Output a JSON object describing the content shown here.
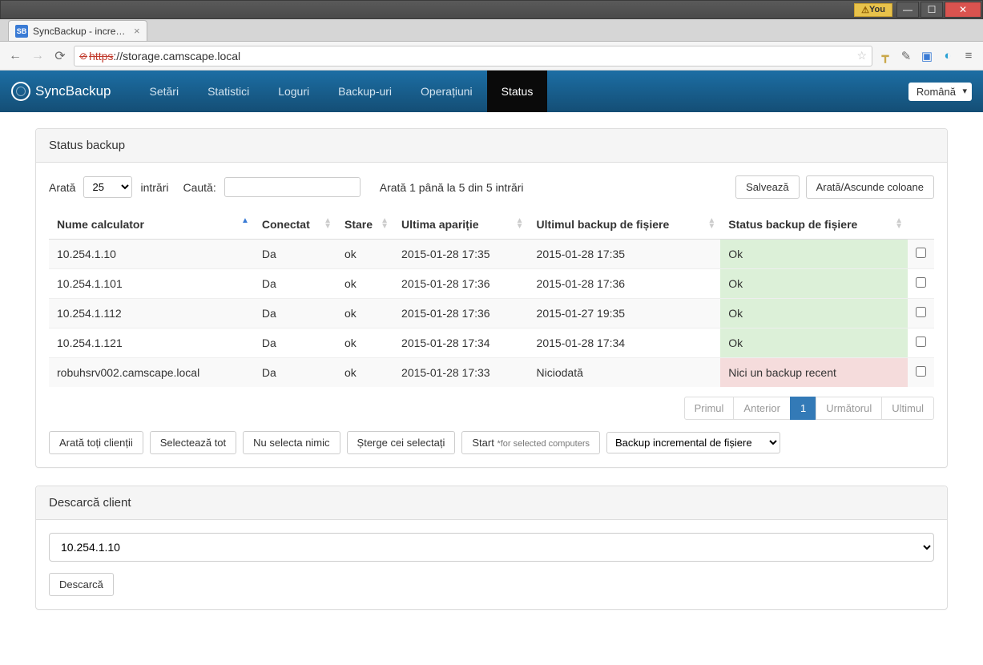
{
  "window": {
    "user_badge": "You",
    "tab_title": "SyncBackup - incremental",
    "tab_favicon": "SB",
    "url_proto": "https",
    "url_rest": "://storage.camscape.local"
  },
  "nav": {
    "brand": "SyncBackup",
    "items": [
      "Setări",
      "Statistici",
      "Loguri",
      "Backup-uri",
      "Operațiuni",
      "Status"
    ],
    "active_index": 5,
    "language": "Română"
  },
  "status_panel": {
    "title": "Status backup",
    "show_label": "Arată",
    "entries_label": "intrări",
    "page_length": "25",
    "search_label": "Caută:",
    "search_value": "",
    "info_text": "Arată 1 până la 5 din 5 intrări",
    "save_btn": "Salvează",
    "columns_btn": "Arată/Ascunde coloane",
    "headers": [
      "Nume calculator",
      "Conectat",
      "Stare",
      "Ultima apariție",
      "Ultimul backup de fișiere",
      "Status backup de fișiere"
    ],
    "rows": [
      {
        "name": "10.254.1.10",
        "online": "Da",
        "state": "ok",
        "last_seen": "2015-01-28 17:35",
        "last_backup": "2015-01-28 17:35",
        "status": "Ok",
        "status_class": "ok"
      },
      {
        "name": "10.254.1.101",
        "online": "Da",
        "state": "ok",
        "last_seen": "2015-01-28 17:36",
        "last_backup": "2015-01-28 17:36",
        "status": "Ok",
        "status_class": "ok"
      },
      {
        "name": "10.254.1.112",
        "online": "Da",
        "state": "ok",
        "last_seen": "2015-01-28 17:36",
        "last_backup": "2015-01-27 19:35",
        "status": "Ok",
        "status_class": "ok"
      },
      {
        "name": "10.254.1.121",
        "online": "Da",
        "state": "ok",
        "last_seen": "2015-01-28 17:34",
        "last_backup": "2015-01-28 17:34",
        "status": "Ok",
        "status_class": "ok"
      },
      {
        "name": "robuhsrv002.camscape.local",
        "online": "Da",
        "state": "ok",
        "last_seen": "2015-01-28 17:33",
        "last_backup": "Niciodată",
        "status": "Nici un backup recent",
        "status_class": "err"
      }
    ],
    "pager": {
      "first": "Primul",
      "prev": "Anterior",
      "page": "1",
      "next": "Următorul",
      "last": "Ultimul"
    },
    "actions": {
      "show_all": "Arată toți clienții",
      "select_all": "Selectează tot",
      "select_none": "Nu selecta nimic",
      "delete_selected": "Șterge cei selectați",
      "start_prefix": "Start ",
      "start_suffix": "*for selected computers",
      "backup_type": "Backup incremental de fișiere"
    }
  },
  "download_panel": {
    "title": "Descarcă client",
    "selected_client": "10.254.1.10",
    "download_btn": "Descarcă"
  }
}
